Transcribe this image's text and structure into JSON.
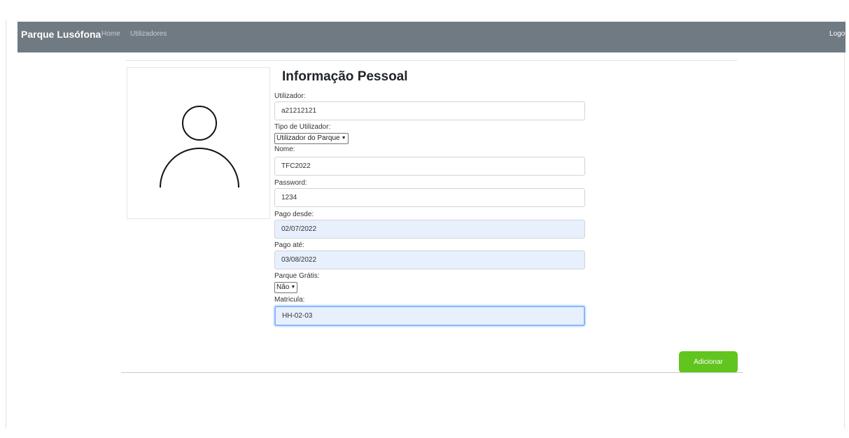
{
  "navbar": {
    "brand": "Parque Lusófona",
    "links": [
      "Home",
      "Utilizadores"
    ],
    "logout": "Logout"
  },
  "avatar": {
    "icon": "user-avatar-icon"
  },
  "form": {
    "title": "Informação Pessoal",
    "utilizador": {
      "label": "Utilizador:",
      "value": "a21212121"
    },
    "tipo": {
      "label": "Tipo de Utilizador:",
      "selected": "Utilizador do Parque"
    },
    "nome": {
      "label": "Nome:",
      "value": "TFC2022"
    },
    "password": {
      "label": "Password:",
      "value": "1234"
    },
    "pago_desde": {
      "label": "Pago desde:",
      "value": "02/07/2022"
    },
    "pago_ate": {
      "label": "Pago até:",
      "value": "03/08/2022"
    },
    "parque_gratis": {
      "label": "Parque Grátis:",
      "selected": "Não"
    },
    "matricula": {
      "label": "Matricula:",
      "value": "HH-02-03"
    },
    "submit": "Adicionar"
  },
  "colors": {
    "navbar_bg": "#707a83",
    "button_bg": "#62c41f",
    "autofill_bg": "#e8f0fe"
  }
}
